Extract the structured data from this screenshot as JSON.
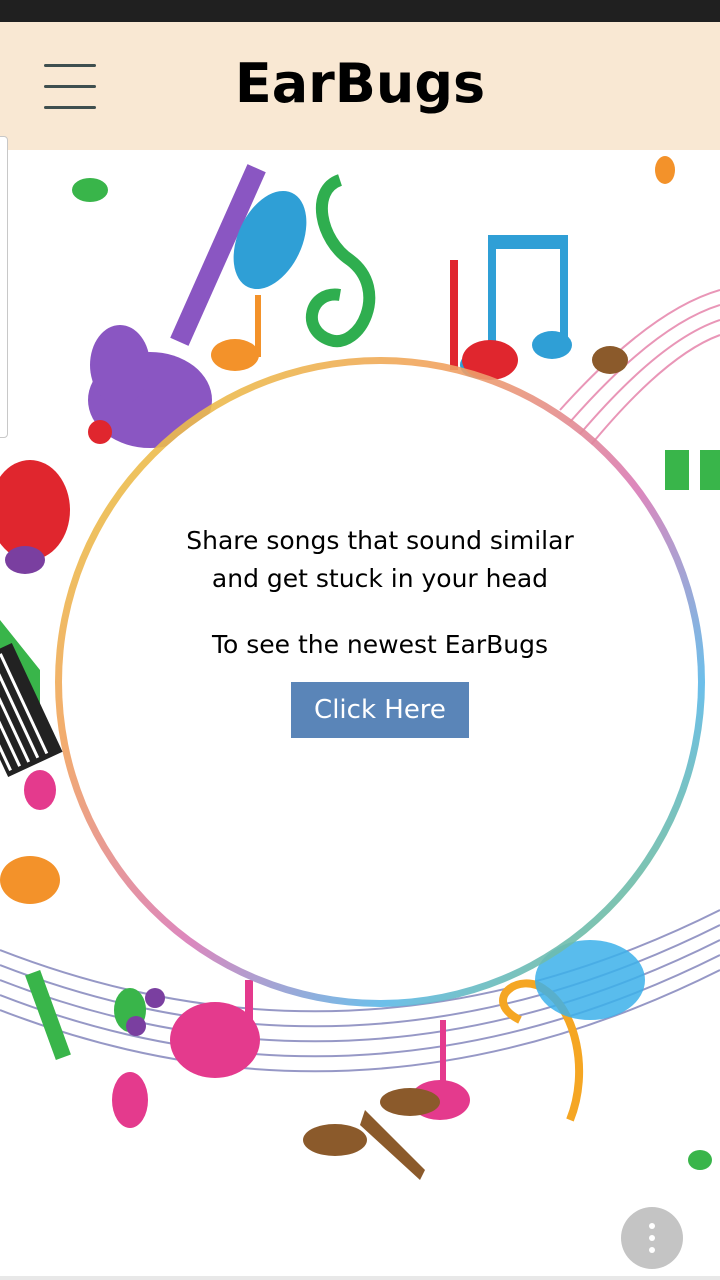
{
  "header": {
    "title": "EarBugs",
    "menu_icon": "hamburger-menu-icon",
    "background": "#f9e8d3"
  },
  "main": {
    "tagline": "Share songs that sound similar and get stuck in your head",
    "cta_text": "To see the newest EarBugs",
    "cta_button_label": "Click Here",
    "cta_button_color": "#5a85b8"
  },
  "fab": {
    "icon": "more-vertical-icon"
  }
}
